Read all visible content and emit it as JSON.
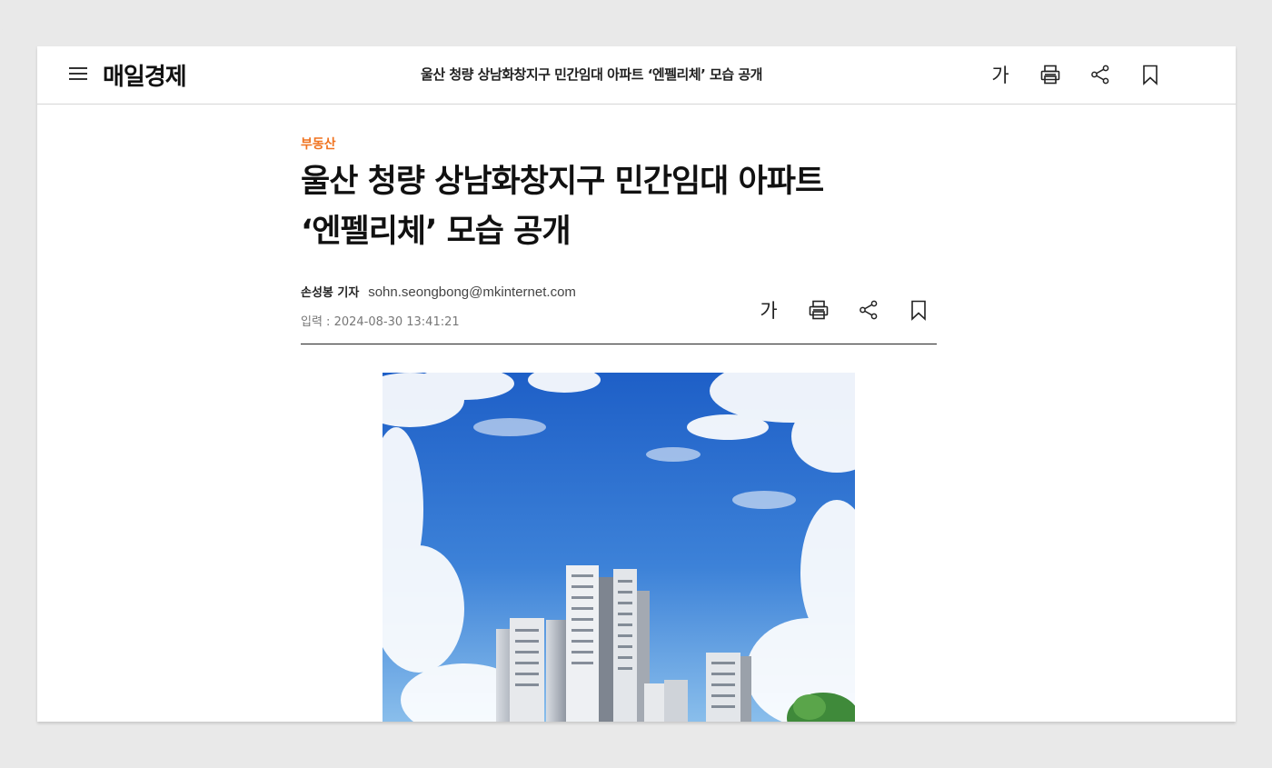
{
  "header": {
    "logo": "매일경제",
    "title": "울산 청량 상남화창지구 민간임대 아파트 ‘엔펠리체’ 모습 공개",
    "font_tool_label": "가"
  },
  "article": {
    "category": "부동산",
    "headline_line1": "울산 청량 상남화창지구 민간임대 아파트",
    "headline_line2": "‘엔펠리체’ 모습 공개",
    "author": "손성봉 기자",
    "email": "sohn.seongbong@mkinternet.com",
    "date_label": "입력 : ",
    "date": "2024-08-30 13:41:21",
    "font_tool_label": "가"
  },
  "icons": [
    "menu-icon",
    "print-icon",
    "share-icon",
    "bookmark-icon"
  ],
  "colors": {
    "category": "#f07320",
    "sky": "#3a78d6"
  }
}
